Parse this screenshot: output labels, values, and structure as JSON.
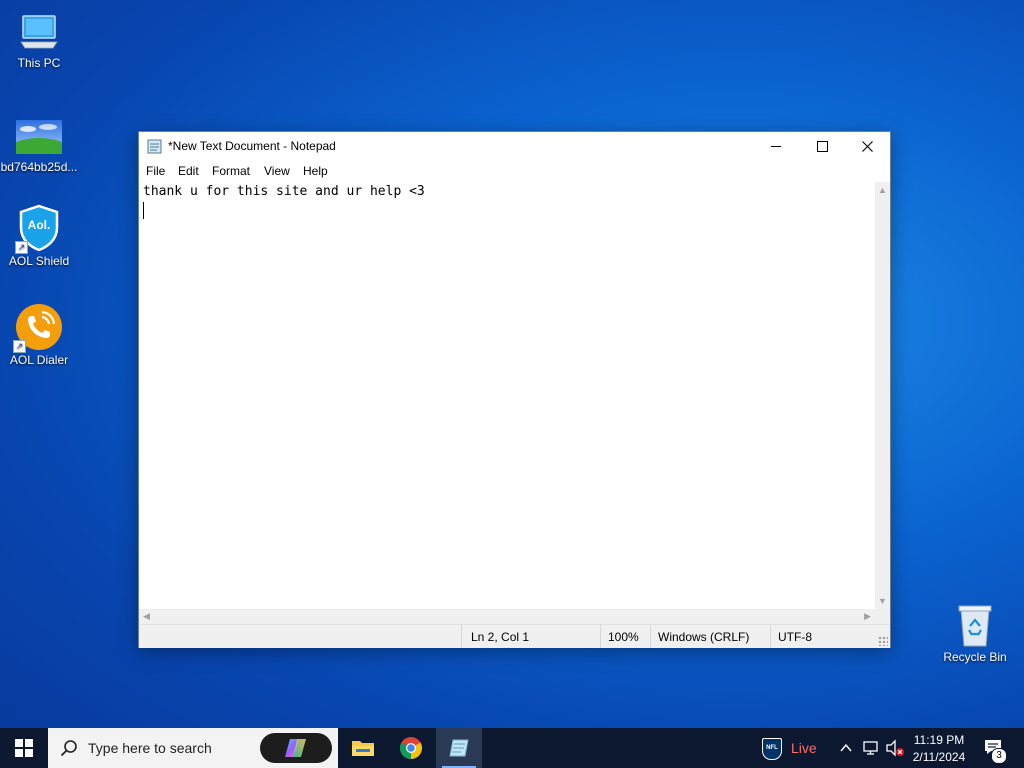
{
  "desktop": {
    "icons": [
      {
        "label": "This PC"
      },
      {
        "label": "bd764bb25d..."
      },
      {
        "label": "AOL Shield",
        "badge": "Aol."
      },
      {
        "label": "AOL Dialer"
      },
      {
        "label": "Recycle Bin"
      }
    ]
  },
  "notepad": {
    "title": "*New Text Document - Notepad",
    "menu": [
      "File",
      "Edit",
      "Format",
      "View",
      "Help"
    ],
    "content": "thank u for this site and ur help <3",
    "status": {
      "position": "Ln 2, Col 1",
      "zoom": "100%",
      "line_ending": "Windows (CRLF)",
      "encoding": "UTF-8"
    },
    "controls": {
      "minimize": "minimize-icon",
      "maximize": "maximize-icon",
      "close": "close-icon"
    }
  },
  "taskbar": {
    "search_placeholder": "Type here to search",
    "apps": [
      "file-explorer-icon",
      "chrome-icon",
      "notepad-icon"
    ],
    "news": {
      "label": "Live",
      "badge": "NFL"
    },
    "clock": {
      "time": "11:19 PM",
      "date": "2/11/2024"
    },
    "notifications": {
      "count": "3"
    }
  },
  "colors": {
    "desktop_accent": "#0b63d0",
    "taskbar": "#0b1830",
    "live_text": "#ff6b6b"
  }
}
